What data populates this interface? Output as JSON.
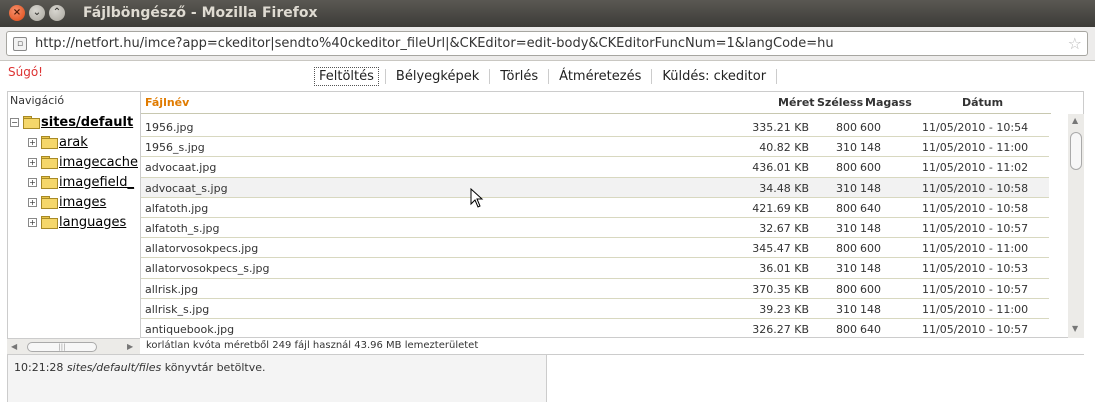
{
  "window": {
    "title": "Fájlböngésző - Mozilla Firefox",
    "url": "http://netfort.hu/imce?app=ckeditor|sendto%40ckeditor_fileUrl|&CKEditor=edit-body&CKEditorFuncNum=1&langCode=hu"
  },
  "help_label": "Súgó!",
  "operations": [
    {
      "label": "Feltöltés",
      "active": true
    },
    {
      "label": "Bélyegképek"
    },
    {
      "label": "Törlés"
    },
    {
      "label": "Átméretezés"
    },
    {
      "label": "Küldés: ckeditor"
    }
  ],
  "navigation": {
    "heading": "Navigáció",
    "root": "sites/default",
    "folders": [
      "arak",
      "imagecache",
      "imagefield_",
      "images",
      "languages"
    ]
  },
  "file_list": {
    "headers": {
      "name": "Fájlnév",
      "size": "Méret",
      "width": "Széless",
      "height": "Magass",
      "date": "Dátum"
    },
    "rows": [
      {
        "name": "1956.jpg",
        "size": "335.21 KB",
        "width": "800",
        "height": "600",
        "date": "11/05/2010 - 10:54"
      },
      {
        "name": "1956_s.jpg",
        "size": "40.82 KB",
        "width": "310",
        "height": "148",
        "date": "11/05/2010 - 11:00"
      },
      {
        "name": "advocaat.jpg",
        "size": "436.01 KB",
        "width": "800",
        "height": "600",
        "date": "11/05/2010 - 11:02"
      },
      {
        "name": "advocaat_s.jpg",
        "size": "34.48 KB",
        "width": "310",
        "height": "148",
        "date": "11/05/2010 - 10:58",
        "highlight": true
      },
      {
        "name": "alfatoth.jpg",
        "size": "421.69 KB",
        "width": "800",
        "height": "640",
        "date": "11/05/2010 - 10:58"
      },
      {
        "name": "alfatoth_s.jpg",
        "size": "32.67 KB",
        "width": "310",
        "height": "148",
        "date": "11/05/2010 - 10:57"
      },
      {
        "name": "allatorvosokpecs.jpg",
        "size": "345.47 KB",
        "width": "800",
        "height": "600",
        "date": "11/05/2010 - 11:00"
      },
      {
        "name": "allatorvosokpecs_s.jpg",
        "size": "36.01 KB",
        "width": "310",
        "height": "148",
        "date": "11/05/2010 - 10:53"
      },
      {
        "name": "allrisk.jpg",
        "size": "370.35 KB",
        "width": "800",
        "height": "600",
        "date": "11/05/2010 - 10:57"
      },
      {
        "name": "allrisk_s.jpg",
        "size": "39.23 KB",
        "width": "310",
        "height": "148",
        "date": "11/05/2010 - 11:00"
      },
      {
        "name": "antiquebook.jpg",
        "size": "326.27 KB",
        "width": "800",
        "height": "640",
        "date": "11/05/2010 - 10:57"
      }
    ]
  },
  "status_text": "korlátlan kvóta méretből 249 fájl használ 43.96 MB lemezterületet",
  "log": {
    "time": "10:21:28",
    "path": "sites/default/files",
    "message": "könyvtár betöltve."
  }
}
